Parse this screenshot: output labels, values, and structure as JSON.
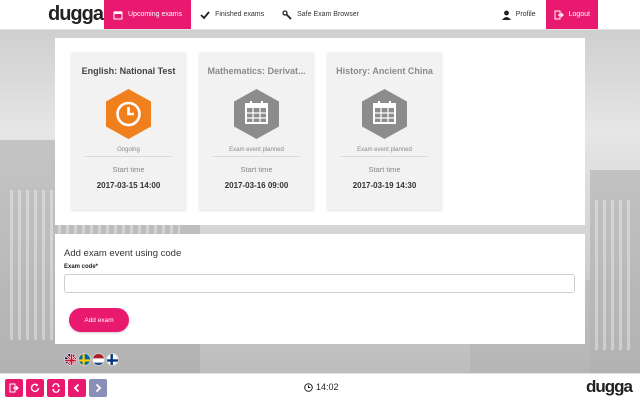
{
  "brand": {
    "logo_text": "dugga",
    "accent": "#e8196e"
  },
  "nav": {
    "items": [
      {
        "label": "Upcoming exams",
        "icon": "calendar-icon",
        "active": true
      },
      {
        "label": "Finished exams",
        "icon": "checkmark-icon",
        "active": false
      },
      {
        "label": "Safe Exam Browser",
        "icon": "wrench-icon",
        "active": false
      }
    ],
    "profile": "Profile",
    "logout": "Logout"
  },
  "exams": [
    {
      "title": "English: National Test",
      "status": "Ongoing",
      "start_label": "Start time",
      "start": "2017-03-15 14:00",
      "icon": "clock-icon",
      "color": "#f0801e"
    },
    {
      "title": "Mathematics: Derivat...",
      "status": "Exam event planned",
      "start_label": "Start time",
      "start": "2017-03-16 09:00",
      "icon": "calendar-icon",
      "color": "#8c8c8c"
    },
    {
      "title": "History: Ancient China",
      "status": "Exam event planned",
      "start_label": "Start time",
      "start": "2017-03-19 14:30",
      "icon": "calendar-icon",
      "color": "#8c8c8c"
    }
  ],
  "add_exam": {
    "title": "Add exam event using code",
    "code_label": "Exam code*",
    "code_value": "",
    "code_placeholder": "",
    "button": "Add exam"
  },
  "languages": [
    {
      "name": "english-flag-icon"
    },
    {
      "name": "swedish-flag-icon"
    },
    {
      "name": "dutch-flag-icon"
    },
    {
      "name": "finnish-flag-icon"
    }
  ],
  "footer": {
    "controls": [
      "exit-icon",
      "refresh-icon",
      "sync-icon",
      "back-icon",
      "forward-icon"
    ],
    "time": "14:02",
    "logo_text": "dugga"
  }
}
